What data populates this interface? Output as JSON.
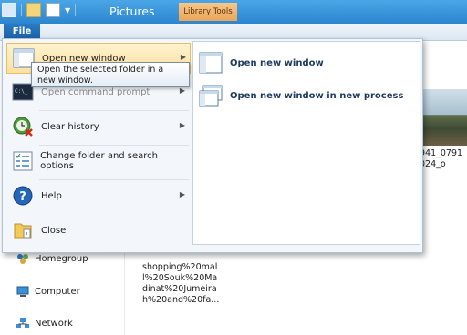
{
  "window": {
    "title": "Pictures",
    "contextual_tab": "Library Tools",
    "file_tab": "File"
  },
  "nav": {
    "items": [
      {
        "label": "Homegroup",
        "icon": "homegroup-icon"
      },
      {
        "label": "Computer",
        "icon": "computer-icon"
      },
      {
        "label": "Network",
        "icon": "network-icon"
      }
    ]
  },
  "content": {
    "thumb_label_lines": [
      "941_0791",
      "024_o"
    ],
    "file_label_lines": [
      "shopping%20mal",
      "l%20Souk%20Ma",
      "dinat%20Jumeira",
      "h%20and%20fa..."
    ]
  },
  "menu": {
    "items": [
      {
        "label": "Open new window",
        "icon": "window-icon",
        "has_submenu": true,
        "highlighted": true,
        "disabled": false
      },
      {
        "label": "Open command prompt",
        "icon": "command-prompt-icon",
        "has_submenu": true,
        "highlighted": false,
        "disabled": true
      },
      {
        "label": "Clear history",
        "icon": "clear-history-icon",
        "has_submenu": true,
        "highlighted": false,
        "disabled": false
      },
      {
        "label": "Change folder and search options",
        "icon": "folder-options-icon",
        "has_submenu": false,
        "highlighted": false,
        "disabled": false
      },
      {
        "label": "Help",
        "icon": "help-icon",
        "has_submenu": true,
        "highlighted": false,
        "disabled": false
      },
      {
        "label": "Close",
        "icon": "close-folder-icon",
        "has_submenu": false,
        "highlighted": false,
        "disabled": false
      }
    ],
    "submenu": [
      {
        "label": "Open new window",
        "icon": "new-window-icon"
      },
      {
        "label": "Open new window in new process",
        "icon": "new-process-window-icon"
      }
    ],
    "tooltip": "Open the selected folder in a new window."
  },
  "colors": {
    "titlebar": "#2b86cf",
    "highlight": "#fde1a1",
    "contextual_tab": "#eaa559",
    "submenu_text": "#1e3b5e"
  }
}
